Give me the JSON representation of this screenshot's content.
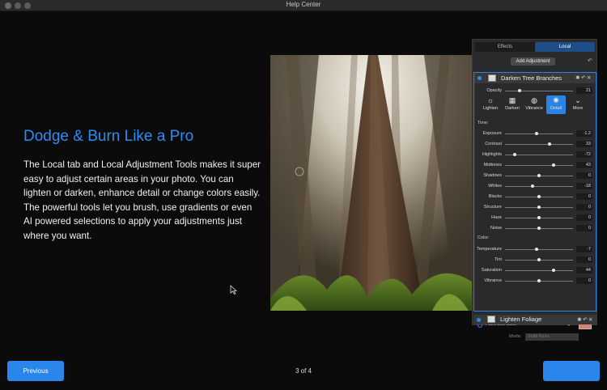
{
  "window": {
    "title": "Help Center"
  },
  "slide": {
    "heading": "Dodge & Burn Like a Pro",
    "body": "The Local tab and Local Adjustment Tools makes it super easy to adjust certain areas in your photo. You can lighten or darken, enhance detail or change colors easily. The powerful tools let you brush, use gradients or even AI powered selections to apply your adjustments just where you want."
  },
  "panel": {
    "tabs": [
      "Effects",
      "Local"
    ],
    "active_tab": "Local",
    "add_adjustment": "Add Adjustment",
    "layer": {
      "name": "Darken Tree Branches",
      "opacity_label": "Opacity",
      "opacity_value": "21",
      "opacity_level": 0.21,
      "tools": [
        {
          "label": "Lighten",
          "icon": "sun-icon"
        },
        {
          "label": "Darken",
          "icon": "checker-icon"
        },
        {
          "label": "Vibrance",
          "icon": "color-wheel-icon"
        },
        {
          "label": "Detail",
          "icon": "detail-icon",
          "active": true
        },
        {
          "label": "More",
          "icon": "chevron-down-icon"
        }
      ],
      "tone_header": "Tone:",
      "tone": [
        {
          "label": "Exposure",
          "value": "-1.2",
          "level": 0.46
        },
        {
          "label": "Contrast",
          "value": "33",
          "level": 0.66
        },
        {
          "label": "Highlights",
          "value": "-72",
          "level": 0.14
        },
        {
          "label": "Midtones",
          "value": "43",
          "level": 0.71
        },
        {
          "label": "Shadows",
          "value": "0",
          "level": 0.5
        },
        {
          "label": "Whites",
          "value": "-18",
          "level": 0.41
        },
        {
          "label": "Blacks",
          "value": "0",
          "level": 0.5
        },
        {
          "label": "Structure",
          "value": "0",
          "level": 0.5
        },
        {
          "label": "Haze",
          "value": "0",
          "level": 0.5
        },
        {
          "label": "Noise",
          "value": "0",
          "level": 0.5
        }
      ],
      "color_header": "Color:",
      "color": [
        {
          "label": "Temperature",
          "value": "-7",
          "level": 0.46
        },
        {
          "label": "Tint",
          "value": "0",
          "level": 0.5
        },
        {
          "label": "Saturation",
          "value": "44",
          "level": 0.72
        },
        {
          "label": "Vibrance",
          "value": "0",
          "level": 0.5
        }
      ],
      "paint_with_color": "Paint with Color",
      "paint_color": "#d98070",
      "mode_label": "Mode:",
      "mode_value": "Solid Paint"
    },
    "second_layer": {
      "name": "Lighten Foliage"
    }
  },
  "nav": {
    "previous": "Previous",
    "page": "3 of 4"
  },
  "colors": {
    "accent": "#2b86ec",
    "heading": "#2d8cf0"
  }
}
